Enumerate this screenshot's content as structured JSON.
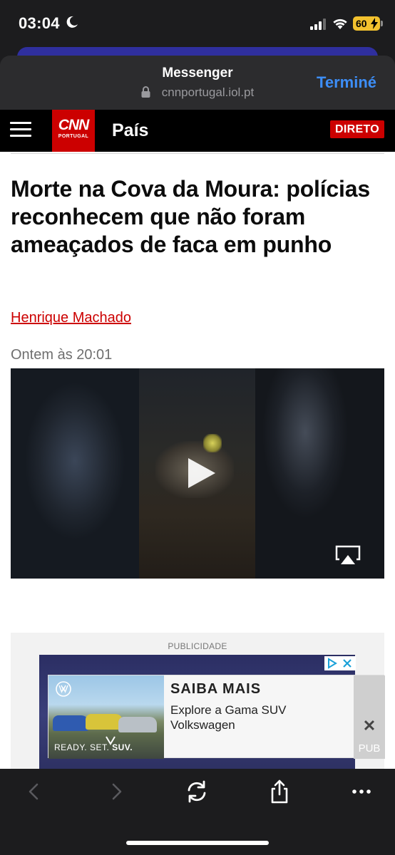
{
  "status_bar": {
    "time": "03:04",
    "battery": "60"
  },
  "browser": {
    "title": "Messenger",
    "url": "cnnportugal.iol.pt",
    "done_label": "Terminé"
  },
  "site_nav": {
    "logo_main": "CNN",
    "logo_sub": "PORTUGAL",
    "section": "País",
    "live_label": "DIRETO"
  },
  "article": {
    "headline": "Morte na Cova da Moura: polícias reconhecem que não foram ameaçados de faca em punho",
    "author": "Henrique Machado",
    "date": "Ontem às 20:01"
  },
  "ad": {
    "label": "PUBLICIDADE",
    "cta_title": "SAIBA MAIS",
    "cta_body": "Explore a Gama SUV Volkswagen",
    "tagline_prefix": "READY. SET. ",
    "tagline_bold": "SUV.",
    "pub_label": "PUB",
    "close_symbol": "✕"
  },
  "colors": {
    "cnn_red": "#cc0000",
    "link_blue": "#3d8ef7",
    "author_red": "#cc0000"
  },
  "icons": [
    "moon-icon",
    "signal-icon",
    "wifi-icon",
    "lock-icon",
    "hamburger-icon",
    "play-icon",
    "airplay-icon",
    "adchoices-icon",
    "back-icon",
    "forward-icon",
    "reload-icon",
    "share-icon",
    "more-icon"
  ]
}
